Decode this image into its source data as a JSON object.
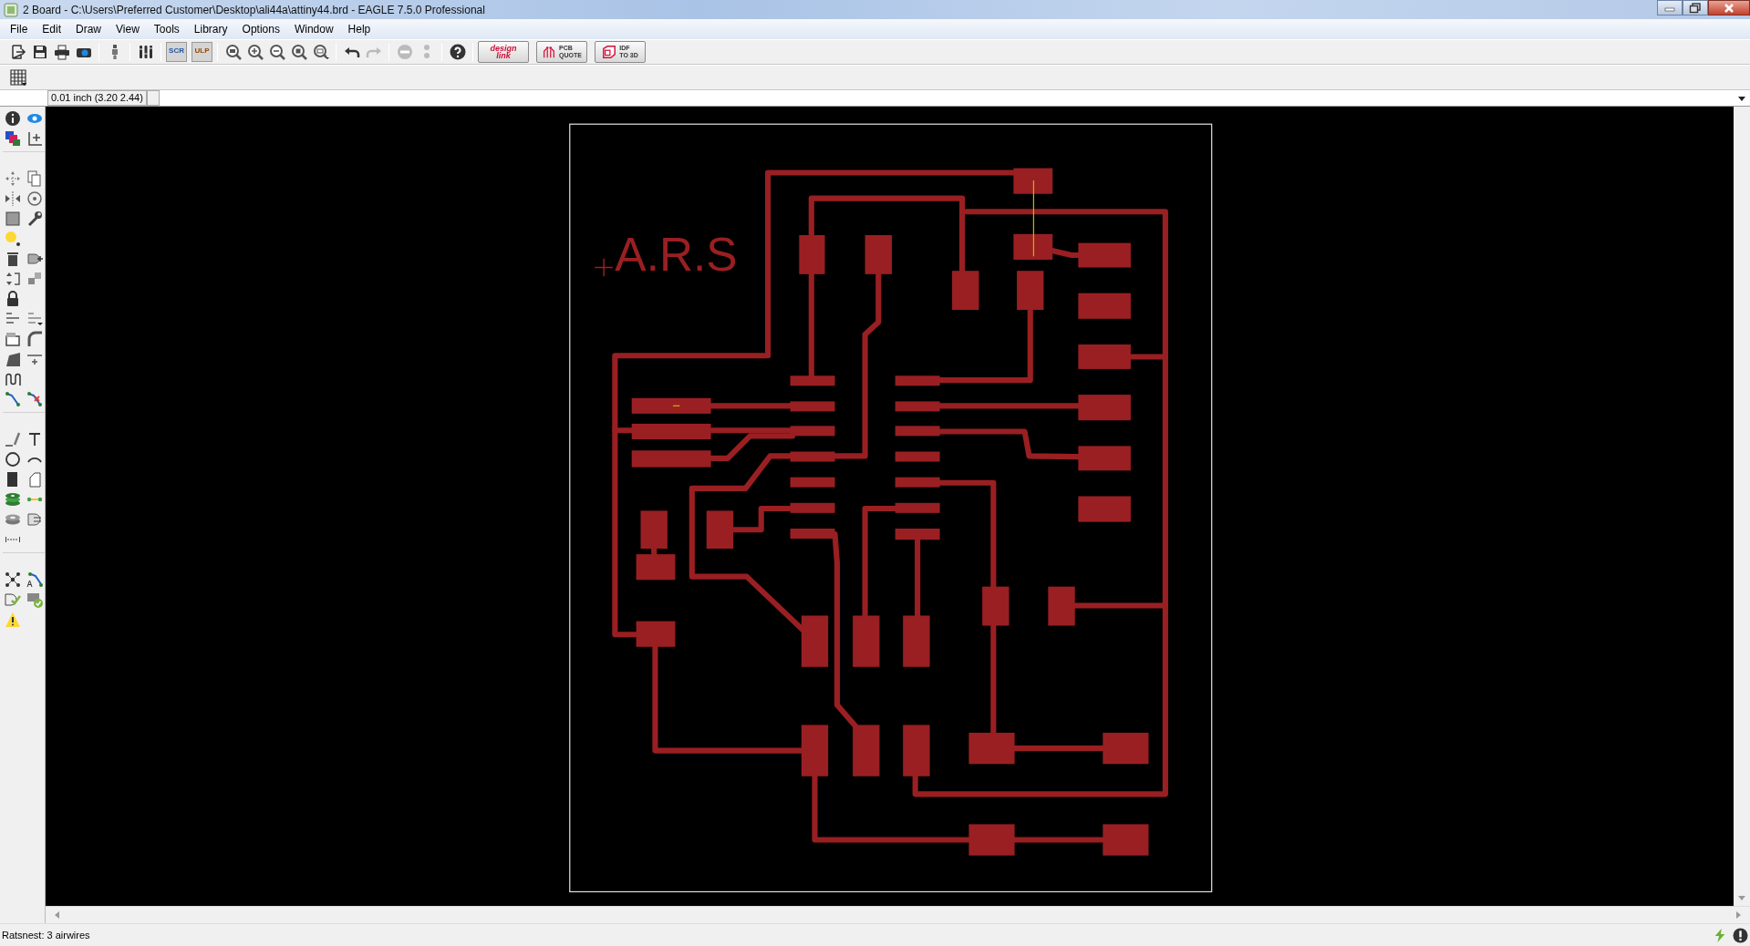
{
  "window": {
    "title": "2 Board - C:\\Users\\Preferred Customer\\Desktop\\ali44a\\attiny44.brd - EAGLE 7.5.0 Professional"
  },
  "menu": [
    "File",
    "Edit",
    "Draw",
    "View",
    "Tools",
    "Library",
    "Options",
    "Window",
    "Help"
  ],
  "toolbar": {
    "script_label": "SCR",
    "ulp_label": "ULP",
    "links": [
      {
        "kind": "design_link",
        "line_1": "design",
        "line_2": "link"
      },
      {
        "kind": "pcb_quote",
        "line_1": "PCB",
        "line_2": "QUOTE"
      },
      {
        "kind": "idf",
        "line_1": "IDF",
        "line_2": "TO 3D"
      }
    ]
  },
  "coordinates": "0.01 inch (3.20 2.44)",
  "board": {
    "label": "A.R.S"
  },
  "status_bar": {
    "message": "Ratsnest: 3 airwires"
  }
}
